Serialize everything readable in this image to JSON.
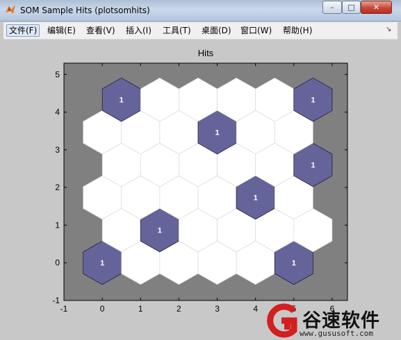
{
  "window": {
    "title": "SOM Sample Hits (plotsomhits)",
    "controls": {
      "minimize": "–",
      "maximize": "□",
      "close": "✕"
    }
  },
  "menu": {
    "items": [
      {
        "label": "文件(F)",
        "active": true
      },
      {
        "label": "编辑(E)"
      },
      {
        "label": "查看(V)"
      },
      {
        "label": "插入(I)"
      },
      {
        "label": "工具(T)"
      },
      {
        "label": "桌面(D)"
      },
      {
        "label": "窗口(W)"
      },
      {
        "label": "帮助(H)"
      }
    ],
    "overflow": "↘"
  },
  "chart_data": {
    "type": "hexagonal-grid",
    "title": "Hits",
    "xlim": [
      -1,
      6.4
    ],
    "ylim": [
      -1,
      5.3
    ],
    "xticks": [
      -1,
      0,
      1,
      2,
      3,
      4,
      5,
      6
    ],
    "yticks": [
      -1,
      0,
      1,
      2,
      3,
      4,
      5
    ],
    "grid_rows": 6,
    "grid_cols": 6,
    "background_color": "#808080",
    "empty_color": "#ffffff",
    "hit_color": "#65649a",
    "hits": [
      {
        "x": 0,
        "y": 0,
        "count": "1"
      },
      {
        "x": 5,
        "y": 0,
        "count": "1"
      },
      {
        "x": 1.5,
        "y": 0.866,
        "count": "1"
      },
      {
        "x": 4,
        "y": 1.732,
        "count": "1"
      },
      {
        "x": 5.5,
        "y": 2.598,
        "count": "1"
      },
      {
        "x": 3,
        "y": 3.464,
        "count": "1"
      },
      {
        "x": 0.5,
        "y": 4.33,
        "count": "1"
      },
      {
        "x": 5.5,
        "y": 4.33,
        "count": "1"
      }
    ]
  },
  "watermark": {
    "brand": "谷速软件",
    "url": "www.gususoft.com"
  }
}
